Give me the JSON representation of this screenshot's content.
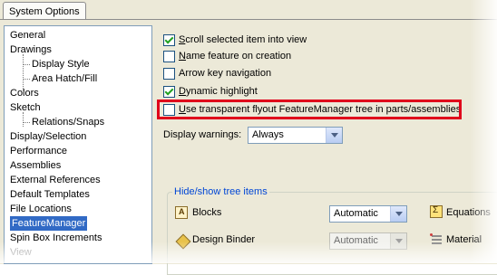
{
  "window": {
    "title": "System Options"
  },
  "tree": {
    "items": [
      {
        "label": "General",
        "child": false
      },
      {
        "label": "Drawings",
        "child": false
      },
      {
        "label": "Display Style",
        "child": true
      },
      {
        "label": "Area Hatch/Fill",
        "child": true
      },
      {
        "label": "Colors",
        "child": false
      },
      {
        "label": "Sketch",
        "child": false
      },
      {
        "label": "Relations/Snaps",
        "child": true
      },
      {
        "label": "Display/Selection",
        "child": false
      },
      {
        "label": "Performance",
        "child": false
      },
      {
        "label": "Assemblies",
        "child": false
      },
      {
        "label": "External References",
        "child": false
      },
      {
        "label": "Default Templates",
        "child": false
      },
      {
        "label": "File Locations",
        "child": false
      },
      {
        "label": "FeatureManager",
        "child": false,
        "selected": true
      },
      {
        "label": "Spin Box Increments",
        "child": false
      },
      {
        "label": "View",
        "child": false
      }
    ]
  },
  "options": {
    "scroll_selected": {
      "prefix": "S",
      "rest": "croll selected item into view",
      "checked": true
    },
    "name_feature": {
      "prefix": "N",
      "rest": "ame feature on creation",
      "checked": false
    },
    "arrow_key": {
      "prefix": "",
      "rest": "Arrow key navigation",
      "checked": false
    },
    "dynamic_highlight": {
      "prefix": "D",
      "rest": "ynamic highlight",
      "checked": true
    },
    "transparent_flyout": {
      "prefix": "U",
      "rest": "se transparent flyout FeatureManager tree in parts/assemblies",
      "checked": false
    }
  },
  "display_warnings": {
    "label": "Display warnings:",
    "value": "Always"
  },
  "hide_show": {
    "title": "Hide/show tree items",
    "rows": [
      {
        "label": "Blocks",
        "icon": "blocks-icon",
        "value": "Automatic",
        "enabled": true
      },
      {
        "label": "Design Binder",
        "icon": "design-binder-icon",
        "value": "Automatic",
        "enabled": false
      }
    ],
    "right_rows": [
      {
        "label": "Equations",
        "icon": "equations-icon"
      },
      {
        "label": "Material",
        "icon": "material-icon"
      }
    ]
  },
  "colors": {
    "highlight": "#e0001b",
    "selection": "#316ac5"
  }
}
